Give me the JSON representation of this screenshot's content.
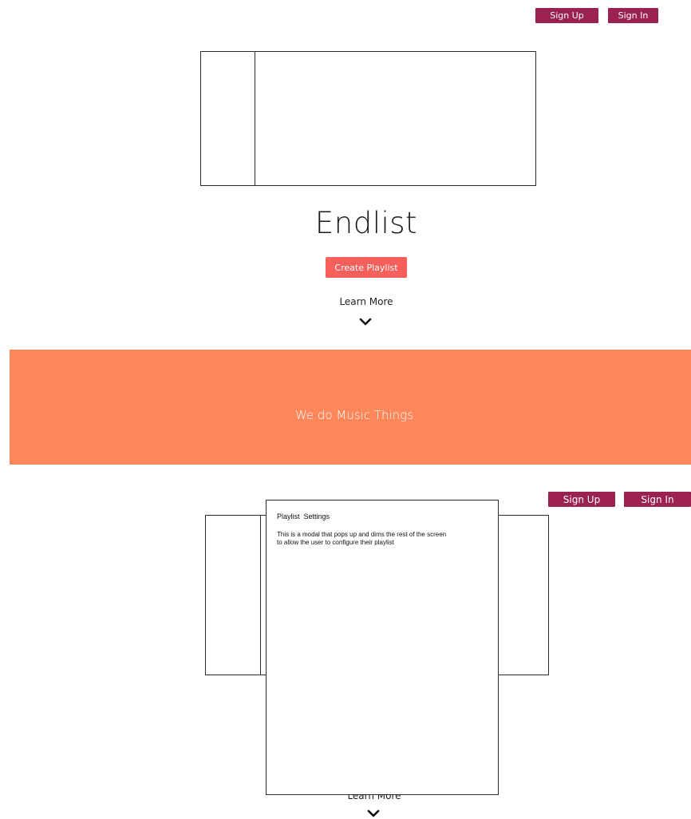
{
  "top_screen": {
    "header": {
      "sign_up_label": "Sign Up",
      "sign_in_label": "Sign In"
    },
    "app_title": "Endlist",
    "create_playlist_label": "Create Playlist",
    "learn_more_label": "Learn More",
    "banner_text": "We do Music Things"
  },
  "modal_screen": {
    "header": {
      "sign_up_label": "Sign Up",
      "sign_in_label": "Sign In"
    },
    "modal": {
      "title": "Playlist  Settings",
      "body": "This is a modal that pops up and dims the rest of the screen to allow the user to configure their playlist"
    },
    "learn_more_label": "Learn More"
  },
  "colors": {
    "header_button": "#9b2150",
    "create_button": "#f65f5a",
    "banner": "#fd865a"
  },
  "icons": {
    "scroll_down": "chevron-down-icon"
  }
}
